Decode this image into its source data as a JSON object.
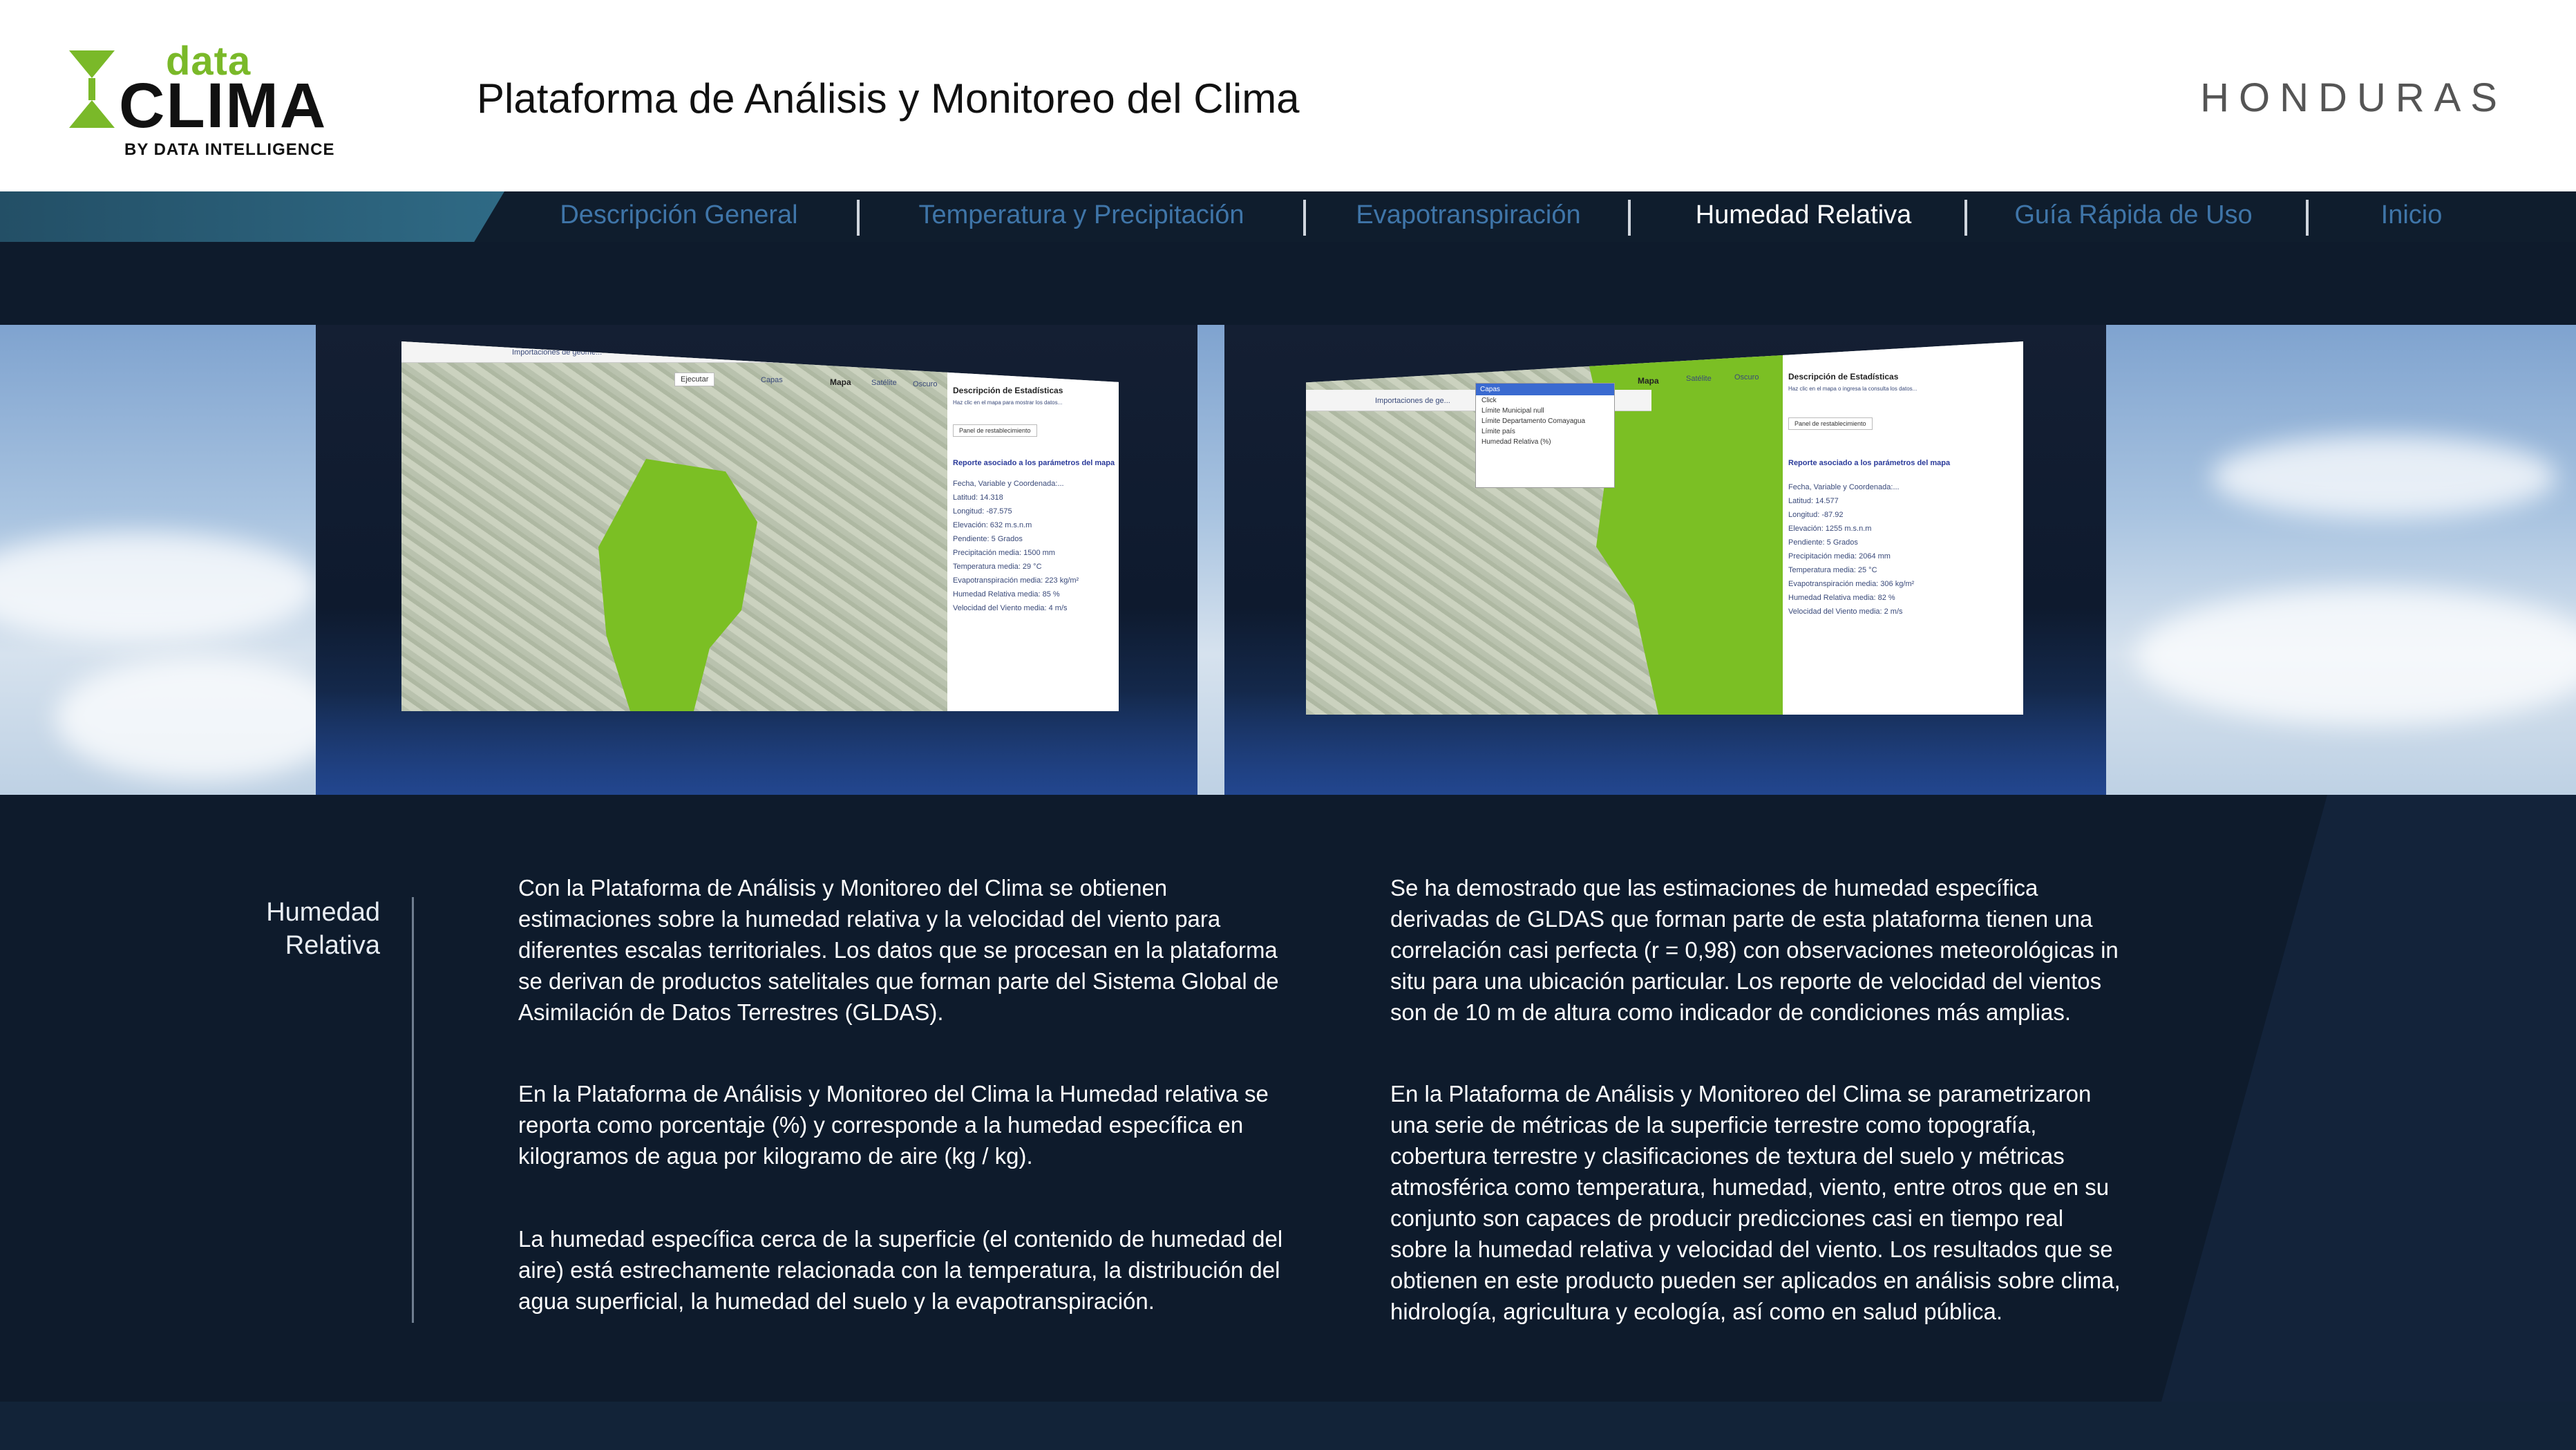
{
  "header": {
    "logo": {
      "word_data": "data",
      "word_clima": "CLIMA",
      "byline": "BY DATA INTELLIGENCE"
    },
    "title": "Plataforma de Análisis y Monitoreo del Clima",
    "country": "HONDURAS"
  },
  "nav": {
    "items": [
      {
        "label": "Descripción General",
        "active": false
      },
      {
        "label": "Temperatura y Precipitación",
        "active": false
      },
      {
        "label": "Evapotranspiración",
        "active": false
      },
      {
        "label": "Humedad Relativa",
        "active": true
      },
      {
        "label": "Guía Rápida de Uso",
        "active": false
      },
      {
        "label": "Inicio",
        "active": false
      }
    ],
    "accent_color": "#2f6a85",
    "active_color": "#ffffff",
    "inactive_color": "#3f75a8"
  },
  "screenshots": {
    "left": {
      "toolbar_search": "Importaciones de geome...",
      "run_button": "Ejecutar",
      "layer_tabs": [
        "Capas",
        "Mapa",
        "Satélite",
        "Oscuro"
      ],
      "panel_title": "Descripción de Estadísticas",
      "panel_hint": "Haz clic en el mapa para mostrar los datos...",
      "reset_button": "Panel de restablecimiento",
      "report_title": "Reporte asociado a los parámetros del mapa",
      "rows": [
        "Fecha, Variable y Coordenada:...",
        "Latitud: 14.318",
        "Longitud: -87.575",
        "Elevación: 632 m.s.n.m",
        "Pendiente: 5 Grados",
        "Precipitación media: 1500 mm",
        "Temperatura media: 29 °C",
        "Evapotranspiración media: 223 kg/m²",
        "Humedad Relativa media: 85 %",
        "Velocidad del Viento media: 4 m/s"
      ]
    },
    "right": {
      "toolbar_search": "Importaciones de ge...",
      "layer_tabs": [
        "Mapa",
        "Satélite",
        "Oscuro"
      ],
      "layers_menu_title": "Capas",
      "layers": [
        "Click",
        "Límite Municipal null",
        "Límite Departamento Comayagua",
        "Límite país",
        "Humedad Relativa (%)"
      ],
      "panel_title": "Descripción de Estadísticas",
      "panel_hint": "Haz clic en el mapa o ingresa la consulta los datos...",
      "reset_button": "Panel de restablecimiento",
      "report_title": "Reporte asociado a los parámetros del mapa",
      "rows": [
        "Fecha, Variable y Coordenada:...",
        "Latitud: 14.577",
        "Longitud: -87.92",
        "Elevación: 1255 m.s.n.m",
        "Pendiente: 5 Grados",
        "Precipitación media: 2064 mm",
        "Temperatura media: 25 °C",
        "Evapotranspiración media: 306 kg/m²",
        "Humedad Relativa media: 82 %",
        "Velocidad del Viento media: 2 m/s"
      ]
    }
  },
  "section": {
    "label_line1": "Humedad",
    "label_line2": "Relativa",
    "col1": [
      "Con la Plataforma de Análisis y Monitoreo del Clima se obtienen estimaciones sobre la humedad relativa y la velocidad del viento para diferentes escalas territoriales. Los datos que se procesan en la plataforma se derivan de productos satelitales que forman parte del Sistema Global de Asimilación de Datos Terrestres (GLDAS).",
      "En la Plataforma de Análisis y Monitoreo del Clima la Humedad relativa se reporta como porcentaje (%) y corresponde a la humedad específica en kilogramos de agua por kilogramo de aire (kg / kg).",
      "La humedad específica cerca de la superficie (el contenido de humedad del aire) está estrechamente relacionada con la temperatura, la distribución del agua superficial, la humedad del suelo y la evapotranspiración."
    ],
    "col2": [
      "Se ha demostrado que las estimaciones de humedad específica derivadas de GLDAS que forman parte de esta plataforma tienen una correlación casi perfecta (r = 0,98) con observaciones meteorológicas in situ para una ubicación particular. Los reporte de velocidad del vientos son de 10 m de altura como indicador de condiciones más amplias.",
      "En la Plataforma de Análisis y Monitoreo del Clima se parametrizaron una serie de métricas de la superficie terrestre como topografía, cobertura terrestre y clasificaciones de textura del suelo y métricas atmosférica como temperatura, humedad, viento, entre otros que en su conjunto son capaces de producir predicciones casi en tiempo real sobre la humedad relativa y velocidad del viento. Los resultados que se obtienen en este producto pueden ser aplicados en análisis sobre clima, hidrología, agricultura y ecología, así como en salud pública."
    ]
  }
}
